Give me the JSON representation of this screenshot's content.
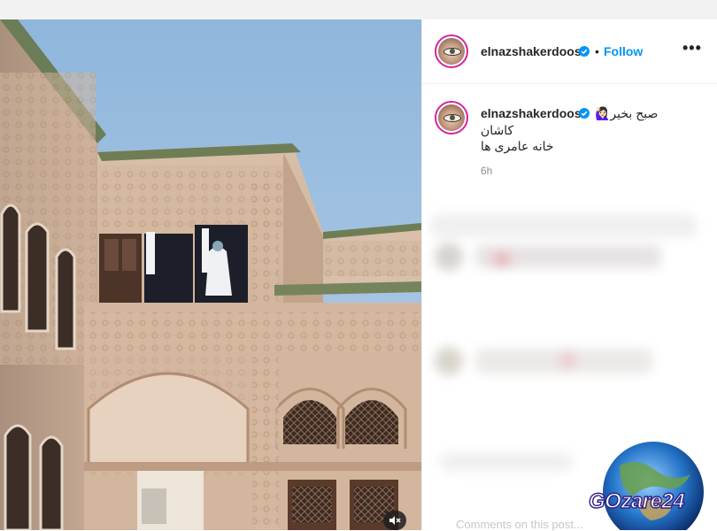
{
  "post": {
    "username": "elnazshakerdoost",
    "separator": "•",
    "follow_label": "Follow",
    "more_label": "•••",
    "caption_lines": [
      "صبح بخیر🙋🏻‍♀️",
      "کاشان",
      "خانه عامری ها"
    ],
    "time_ago": "6h",
    "comment_placeholder": "Comments on this post..."
  },
  "watermark": {
    "text": "GOzare24"
  },
  "colors": {
    "accent": "#0095f6",
    "verified": "#0095f6",
    "ring": "#d6249f"
  },
  "icons": [
    "verified-badge-icon",
    "more-icon",
    "mute-icon",
    "globe-icon"
  ]
}
